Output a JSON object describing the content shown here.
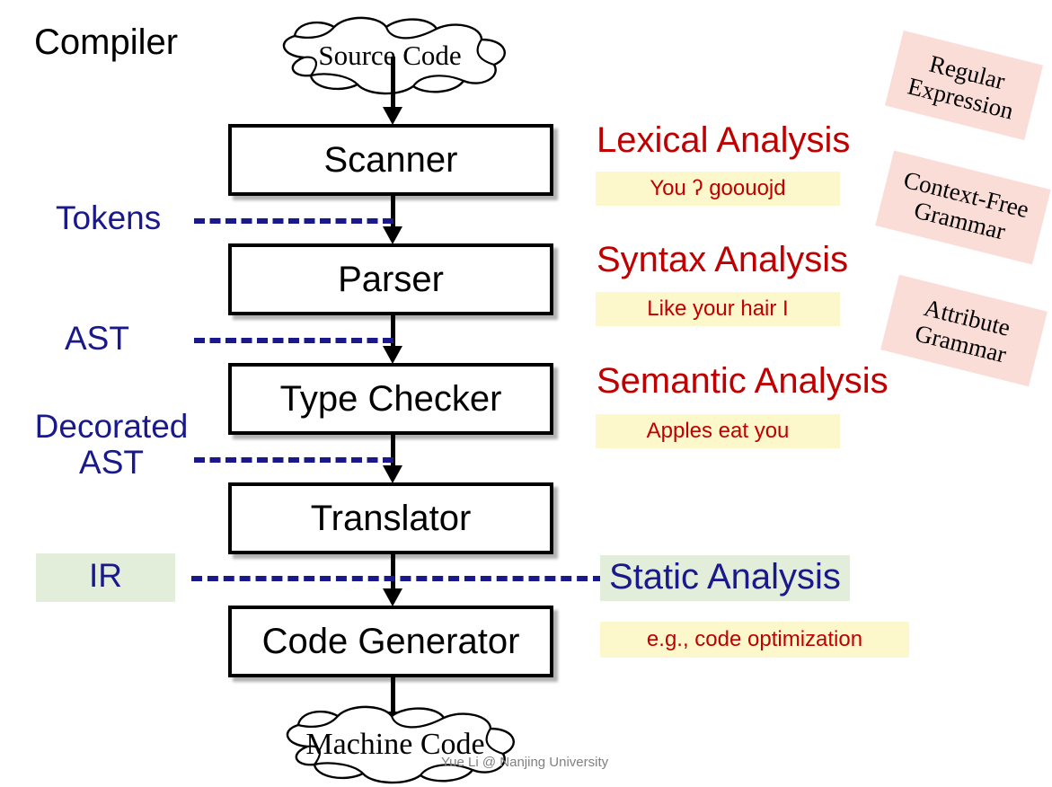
{
  "title": "Compiler",
  "clouds": {
    "input": "Source Code",
    "output": "Machine Code"
  },
  "stages": [
    {
      "name": "Scanner"
    },
    {
      "name": "Parser"
    },
    {
      "name": "Type Checker"
    },
    {
      "name": "Translator"
    },
    {
      "name": "Code Generator"
    }
  ],
  "intermediates": [
    {
      "label": "Tokens"
    },
    {
      "label": "AST"
    },
    {
      "label": "Decorated AST"
    },
    {
      "label": "IR"
    }
  ],
  "phases": [
    {
      "heading": "Lexical Analysis",
      "example": "You ʔ goouojd",
      "tag_line1": "Regular",
      "tag_line2": "Expression"
    },
    {
      "heading": "Syntax Analysis",
      "example": "Like your hair I",
      "tag_line1": "Context-Free",
      "tag_line2": "Grammar"
    },
    {
      "heading": "Semantic Analysis",
      "example": "Apples eat you",
      "tag_line1": "Attribute",
      "tag_line2": "Grammar"
    },
    {
      "heading": "Static Analysis",
      "example": "e.g., code optimization"
    }
  ],
  "footer": "Yue Li @ Nanjing University",
  "colors": {
    "red": "#C00000",
    "blue": "#19198C",
    "pink": "#FBDDD8",
    "yellow": "#FCF8CC",
    "green": "#E2EDDA",
    "black": "#000000"
  }
}
